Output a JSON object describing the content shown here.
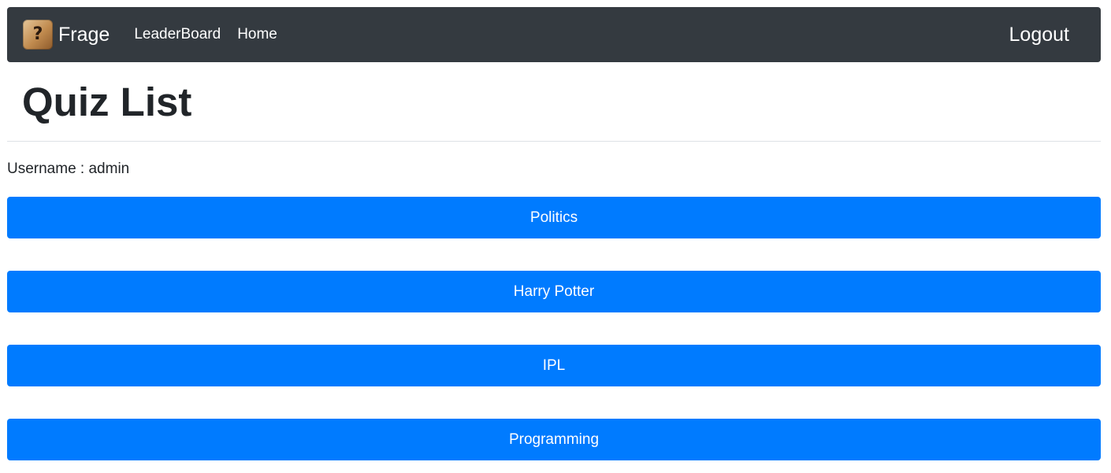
{
  "navbar": {
    "brand": "Frage",
    "logo_icon": "question-block-icon",
    "logo_glyph": "?",
    "links": [
      "LeaderBoard",
      "Home"
    ],
    "logout": "Logout",
    "background_color": "#343a40"
  },
  "page": {
    "title": "Quiz List",
    "username_label": "Username : admin"
  },
  "quizzes": [
    "Politics",
    "Harry Potter",
    "IPL",
    "Programming"
  ],
  "colors": {
    "primary_button": "#007bff",
    "text": "#212529"
  }
}
